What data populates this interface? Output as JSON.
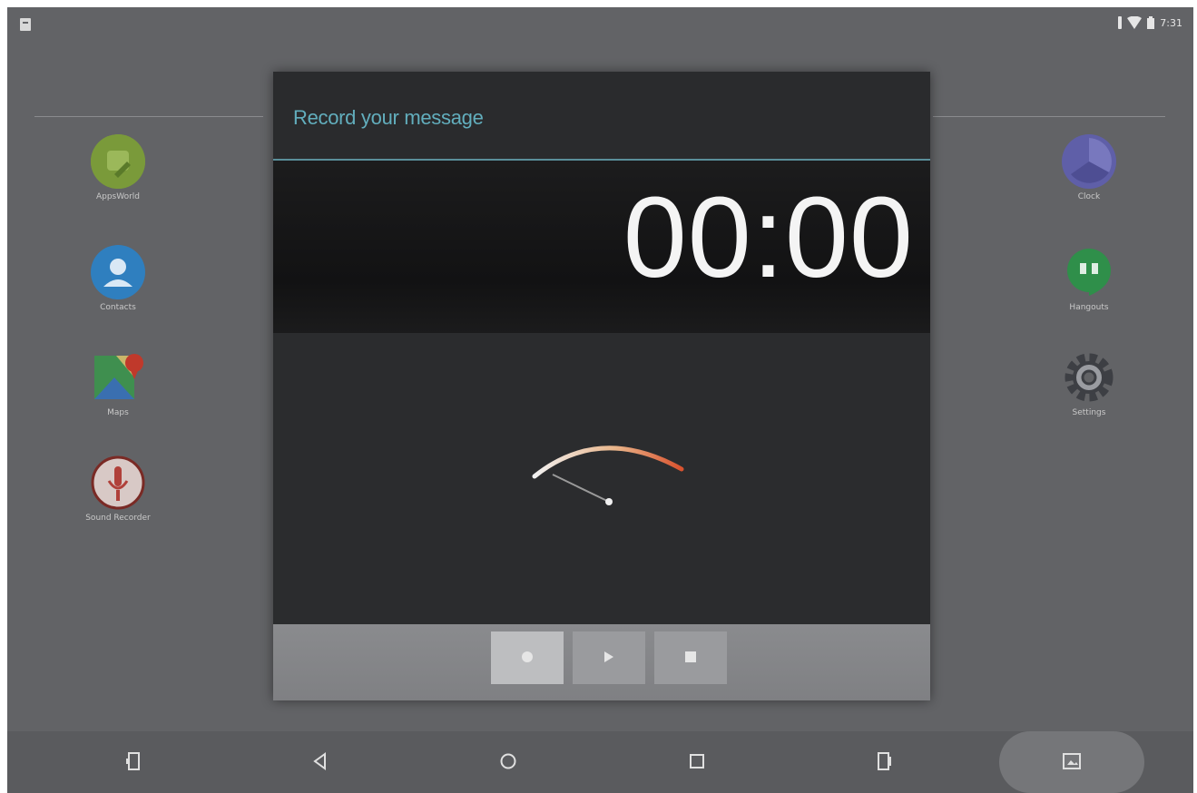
{
  "status_bar": {
    "time": "7:31",
    "left_icon": "notification-icon",
    "right_icons": [
      "bluetooth-icon",
      "wifi-icon",
      "battery-icon"
    ]
  },
  "home_apps_left": [
    {
      "label": "AppsWorld",
      "icon": "android-app-icon",
      "color": "#7a9a3a"
    },
    {
      "label": "Contacts",
      "icon": "contacts-icon",
      "color": "#2f7fbf"
    },
    {
      "label": "Maps",
      "icon": "maps-icon",
      "color": "#3f8f4f"
    },
    {
      "label": "Sound Recorder",
      "icon": "microphone-icon",
      "color": "#b0403a"
    }
  ],
  "home_apps_right": [
    {
      "label": "Clock",
      "icon": "clock-icon",
      "color": "#5f5fa8"
    },
    {
      "label": "Hangouts",
      "icon": "hangouts-icon",
      "color": "#2f8f4a"
    },
    {
      "label": "Settings",
      "icon": "settings-icon",
      "color": "#7f8186"
    }
  ],
  "dialog": {
    "title": "Record your message",
    "timer": "00:00",
    "controls": [
      {
        "name": "record",
        "icon": "record-icon",
        "active": true
      },
      {
        "name": "play",
        "icon": "play-icon",
        "active": false
      },
      {
        "name": "stop",
        "icon": "stop-icon",
        "active": false
      }
    ]
  },
  "nav_bar": {
    "buttons": [
      "volume-down-icon",
      "back-icon",
      "home-icon",
      "recents-icon",
      "volume-up-icon",
      "screenshot-icon"
    ]
  },
  "colors": {
    "title_accent": "#62aebd",
    "background": "#626366",
    "dialog_bg": "#2b2c2e"
  }
}
